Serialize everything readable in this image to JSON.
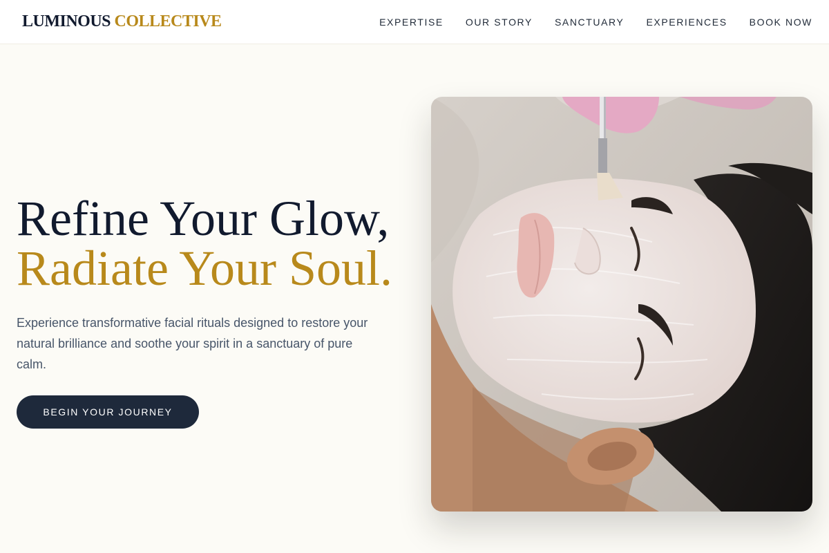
{
  "brand": {
    "part1": "LUMINOUS",
    "part2": "COLLECTIVE"
  },
  "nav": {
    "items": [
      {
        "label": "EXPERTISE"
      },
      {
        "label": "OUR STORY"
      },
      {
        "label": "SANCTUARY"
      },
      {
        "label": "EXPERIENCES"
      },
      {
        "label": "BOOK NOW"
      }
    ]
  },
  "hero": {
    "headline_line1": "Refine Your Glow,",
    "headline_line2": "Radiate Your Soul.",
    "subtitle": "Experience transformative facial rituals designed to restore your natural brilliance and soothe your spirit in a sanctuary of pure calm.",
    "cta_label": "BEGIN YOUR JOURNEY"
  },
  "colors": {
    "navy": "#111a2e",
    "gold": "#b8891b",
    "cta_bg": "#1e293b",
    "page_bg": "#fcfbf6"
  },
  "image": {
    "subject": "facial-treatment-photo"
  }
}
